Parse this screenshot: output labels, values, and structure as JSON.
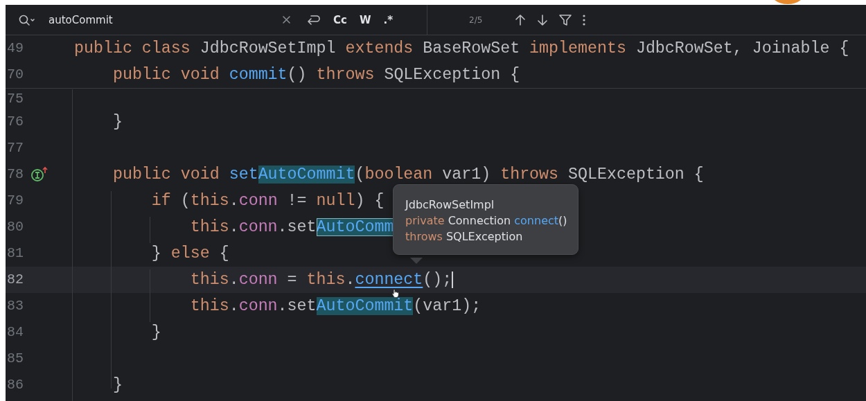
{
  "search": {
    "value": "autoCommit",
    "toggles": [
      {
        "label": "Cc",
        "selected": false
      },
      {
        "label": "W",
        "selected": false
      },
      {
        "label": ".*",
        "selected": false
      }
    ],
    "count": "2/5"
  },
  "sticky_lines": [
    {
      "number": "49",
      "tokens": [
        {
          "text": "public class ",
          "kind": "keyword"
        },
        {
          "text": "JdbcRowSetImpl ",
          "kind": "plain"
        },
        {
          "text": "extends ",
          "kind": "keyword"
        },
        {
          "text": "BaseRowSet ",
          "kind": "plain"
        },
        {
          "text": "implements ",
          "kind": "keyword"
        },
        {
          "text": "JdbcRowSet, Joinable {",
          "kind": "plain"
        }
      ]
    },
    {
      "number": "70",
      "tokens": [
        {
          "text": "    public void ",
          "kind": "keyword"
        },
        {
          "text": "commit",
          "kind": "method"
        },
        {
          "text": "() ",
          "kind": "plain"
        },
        {
          "text": "throws ",
          "kind": "keyword"
        },
        {
          "text": "SQLException {",
          "kind": "plain"
        }
      ]
    }
  ],
  "lines": [
    {
      "number": "75",
      "current": false,
      "clipped": true
    },
    {
      "number": "76",
      "current": false,
      "tokens": [
        {
          "text": "    }",
          "kind": "plain"
        }
      ]
    },
    {
      "number": "77",
      "current": false
    },
    {
      "number": "78",
      "current": false,
      "implements_marker": true,
      "tokens": [
        {
          "text": "    public void ",
          "kind": "keyword"
        },
        {
          "text": "set",
          "kind": "method"
        },
        {
          "text": "AutoCommit",
          "kind": "match",
          "selected": false
        },
        {
          "text": "(",
          "kind": "plain"
        },
        {
          "text": "boolean ",
          "kind": "keyword"
        },
        {
          "text": "var1) ",
          "kind": "plain"
        },
        {
          "text": "throws ",
          "kind": "keyword"
        },
        {
          "text": "SQLException {",
          "kind": "plain"
        }
      ]
    },
    {
      "number": "79",
      "current": false,
      "tokens": [
        {
          "text": "        if ",
          "kind": "keyword"
        },
        {
          "text": "(",
          "kind": "plain"
        },
        {
          "text": "this",
          "kind": "keyword"
        },
        {
          "text": ".",
          "kind": "plain"
        },
        {
          "text": "conn",
          "kind": "field"
        },
        {
          "text": " != ",
          "kind": "plain"
        },
        {
          "text": "null",
          "kind": "keyword"
        },
        {
          "text": ") {",
          "kind": "plain"
        }
      ]
    },
    {
      "number": "80",
      "current": false,
      "tokens": [
        {
          "text": "            this",
          "kind": "keyword"
        },
        {
          "text": ".",
          "kind": "plain"
        },
        {
          "text": "conn",
          "kind": "field"
        },
        {
          "text": ".set",
          "kind": "plain"
        },
        {
          "text": "AutoComm",
          "kind": "match",
          "selected": true
        }
      ]
    },
    {
      "number": "81",
      "current": false,
      "tokens": [
        {
          "text": "        } ",
          "kind": "plain"
        },
        {
          "text": "else ",
          "kind": "keyword"
        },
        {
          "text": "{",
          "kind": "plain"
        }
      ]
    },
    {
      "number": "82",
      "current": true,
      "tokens": [
        {
          "text": "            this",
          "kind": "keyword"
        },
        {
          "text": ".",
          "kind": "plain"
        },
        {
          "text": "conn",
          "kind": "field"
        },
        {
          "text": " = ",
          "kind": "plain"
        },
        {
          "text": "this",
          "kind": "keyword"
        },
        {
          "text": ".",
          "kind": "plain"
        },
        {
          "text": "connect",
          "kind": "link"
        },
        {
          "text": "();",
          "kind": "plain"
        }
      ]
    },
    {
      "number": "83",
      "current": false,
      "tokens": [
        {
          "text": "            this",
          "kind": "keyword"
        },
        {
          "text": ".",
          "kind": "plain"
        },
        {
          "text": "conn",
          "kind": "field"
        },
        {
          "text": ".set",
          "kind": "plain"
        },
        {
          "text": "AutoCommit",
          "kind": "match",
          "selected": false
        },
        {
          "text": "(var1);",
          "kind": "plain"
        }
      ]
    },
    {
      "number": "84",
      "current": false,
      "tokens": [
        {
          "text": "        }",
          "kind": "plain"
        }
      ]
    },
    {
      "number": "85",
      "current": false
    },
    {
      "number": "86",
      "current": false,
      "tokens": [
        {
          "text": "    }",
          "kind": "plain"
        }
      ]
    }
  ],
  "tooltip": {
    "lines": [
      [
        {
          "text": "JdbcRowSetImpl",
          "kind": "plain"
        }
      ],
      [
        {
          "text": "private ",
          "kind": "keyword"
        },
        {
          "text": "Connection ",
          "kind": "plain"
        },
        {
          "text": "connect",
          "kind": "method"
        },
        {
          "text": "()",
          "kind": "plain"
        }
      ],
      [
        {
          "text": "throws ",
          "kind": "keyword"
        },
        {
          "text": "SQLException",
          "kind": "plain"
        }
      ]
    ]
  }
}
